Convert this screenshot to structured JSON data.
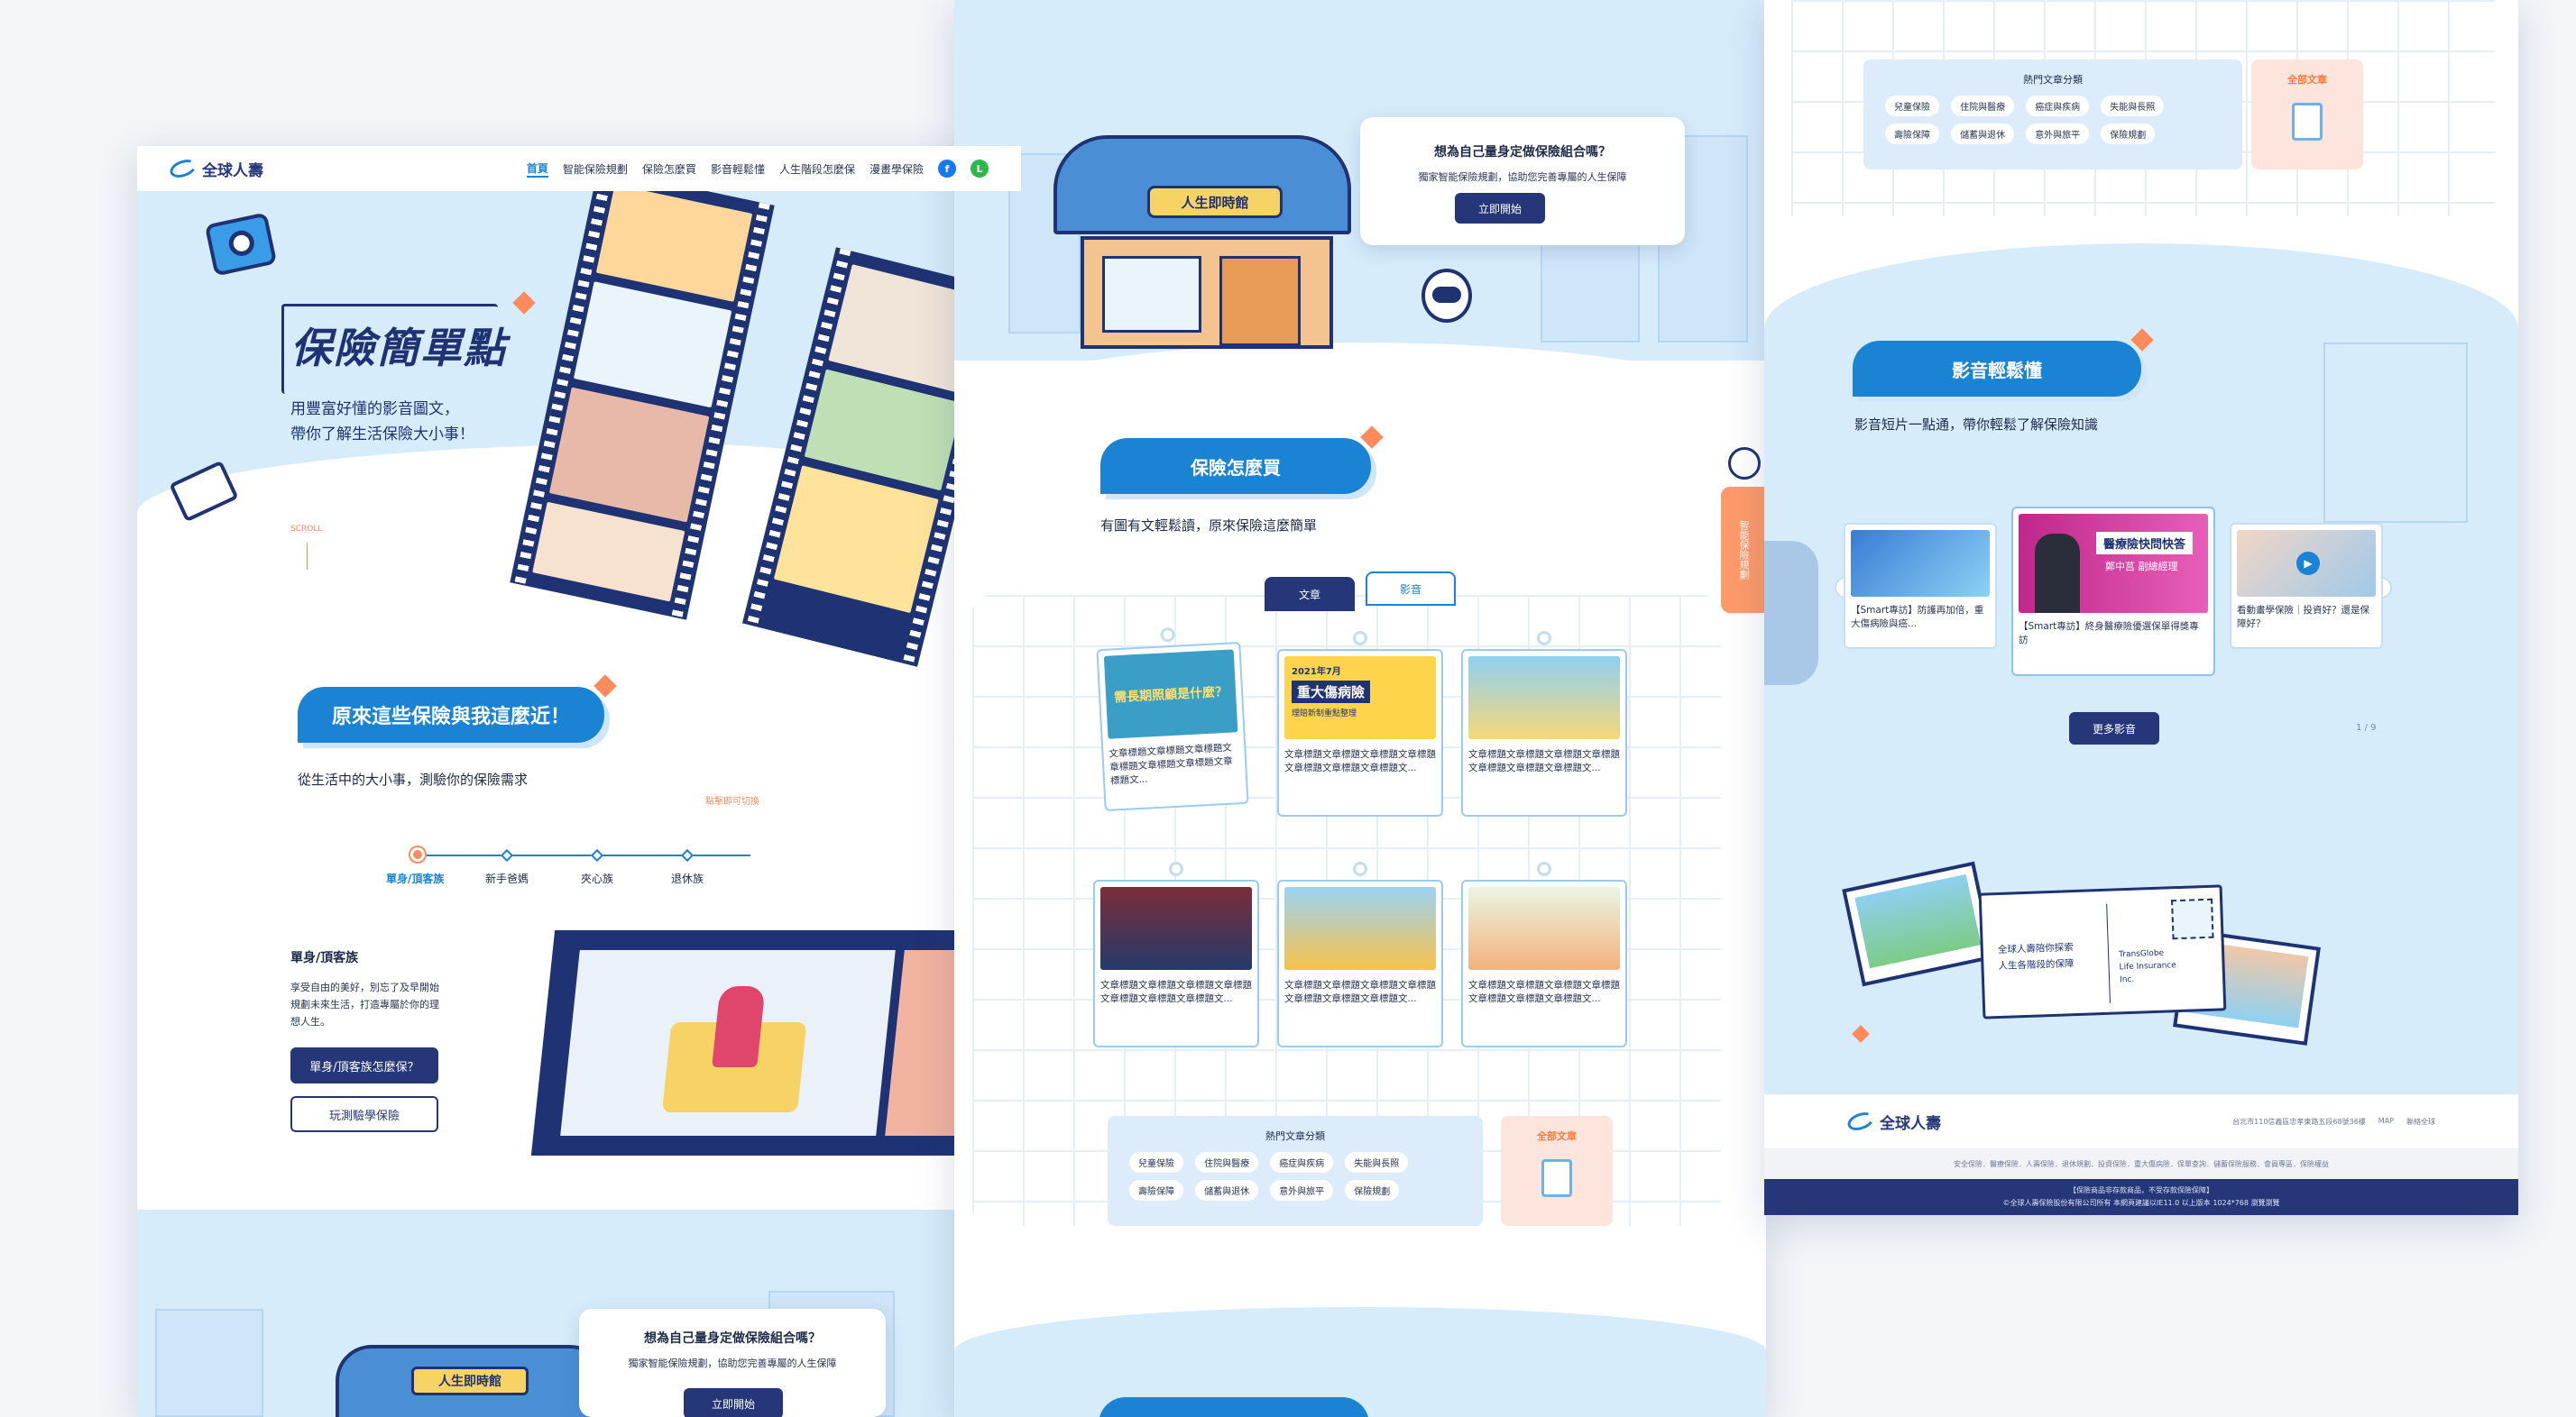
{
  "brand": {
    "logo_text": "全球人壽"
  },
  "nav": {
    "items": [
      "首頁",
      "智能保險規劃",
      "保險怎麼買",
      "影音輕鬆懂",
      "人生階段怎麼保",
      "漫畫學保險"
    ],
    "fb": "f",
    "line": "L"
  },
  "hero": {
    "title": "保險簡單點",
    "subtitle_1": "用豐富好懂的影音圖文，",
    "subtitle_2": "帶你了解生活保險大小事！",
    "scroll": "SCROLL"
  },
  "stages": {
    "heading": "原來這些保險與我這麼近！",
    "subtitle": "從生活中的大小事，測驗你的保險需求",
    "hint": "點擊即可切換",
    "steps": [
      "單身/頂客族",
      "新手爸媽",
      "夾心族",
      "退休族"
    ],
    "detail_title": "單身/頂客族",
    "detail_text_1": "享受自由的美好，別忘了及早開始",
    "detail_text_2": "規劃未來生活，打造專屬於你的理",
    "detail_text_3": "想人生。",
    "btn_primary": "單身/頂客族怎麼保？",
    "btn_secondary": "玩測驗學保險"
  },
  "plan": {
    "question": "想為自己量身定做保險組合嗎？",
    "desc": "獨家智能保險規劃，協助您完善專屬的人生保障",
    "button": "立即開始",
    "store_sign": "人生即時館"
  },
  "howbuy": {
    "heading": "保險怎麼買",
    "subtitle": "有圖有文輕鬆讀，原來保險這麼簡單",
    "tabs": [
      "文章",
      "影音"
    ],
    "side_tab": "智能保險規劃",
    "thumb_texts": [
      "需長期照顧是什麼？",
      "2021年7月",
      "重大傷病險",
      "理賠新制重點整理"
    ],
    "article_text": "文章標題文章標題文章標題文章標題文章標題文章標題文章標題文..."
  },
  "hot": {
    "title": "熱門文章分類",
    "tags": [
      "兒童保險",
      "住院與醫療",
      "癌症與疾病",
      "失能與長照",
      "壽險保障",
      "儲蓄與退休",
      "意外與旅平",
      "保險規劃"
    ],
    "all": "全部文章"
  },
  "video": {
    "heading": "影音輕鬆懂",
    "subtitle": "影音短片一點通，帶你輕鬆了解保險知識",
    "items": [
      "【Smart專訪】防護再加倍，重大傷病險與癌...",
      "【Smart專訪】終身醫療險優選保單得獎專訪",
      "看動畫學保險｜投資好？還是保障好？"
    ],
    "thumb_caption": "醫療險快問快答",
    "thumb_name": "鄭中莒 副總經理",
    "more": "更多影音",
    "pager": "1 / 9"
  },
  "postcard": {
    "line1": "全球人壽陪你探索",
    "line2": "人生各階段的保障",
    "stamp1": "TransGlobe",
    "stamp2": "Life Insurance",
    "stamp3": "Inc."
  },
  "footer": {
    "address": "台北市110信義區忠孝東路五段68號36樓",
    "map": "MAP",
    "service": "聯絡全球",
    "links": "安全保險．醫療保險．人壽保險．退休規劃．投資保險．重大傷病險．保單查詢．儲蓄保險服務．會員專區．保險權益",
    "notice": "【保險商品非存款商品，不受存款保險保障】",
    "copyright": "©全球人壽保險股份有限公司所有 本網頁建議以IE11.0 以上版本 1024*768 瀏覽瀏覽"
  },
  "colors": {
    "primary": "#1b83d4",
    "navy": "#253679",
    "accent": "#ff8a5c",
    "sky": "#d6ecfb"
  }
}
